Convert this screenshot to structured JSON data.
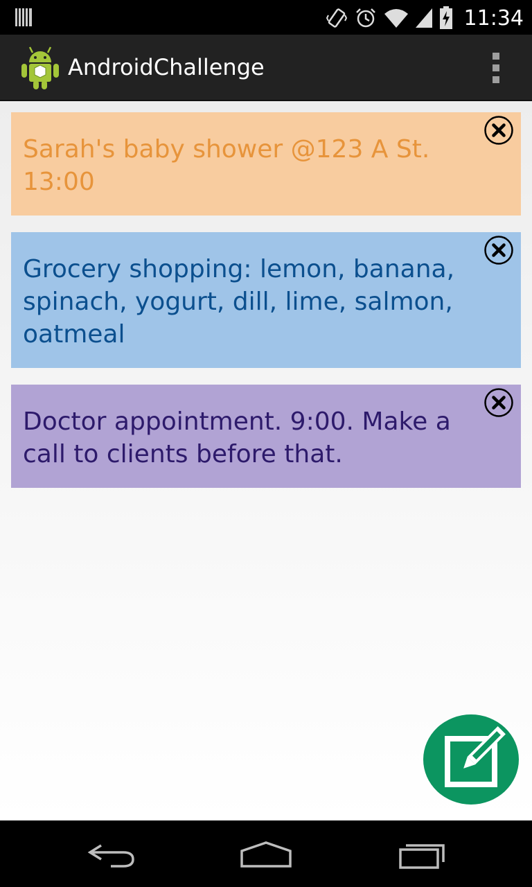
{
  "status_bar": {
    "time": "11:34",
    "icons": [
      "barcode-icon",
      "vibrate-icon",
      "alarm-icon",
      "wifi-icon",
      "signal-icon",
      "battery-charging-icon"
    ]
  },
  "action_bar": {
    "title": "AndroidChallenge",
    "app_icon": "android-robot-icon",
    "overflow_icon": "overflow-menu-icon"
  },
  "notes": [
    {
      "text": "Sarah's baby shower @123 A St. 13:00",
      "bg_color": "#f8cc9f",
      "text_color": "#e7943b"
    },
    {
      "text": "Grocery shopping: lemon, banana, spinach, yogurt, dill, lime, salmon, oatmeal",
      "bg_color": "#9fc4e8",
      "text_color": "#0b4f8e"
    },
    {
      "text": "Doctor appointment. 9:00.  Make a call to clients before that.",
      "bg_color": "#b1a3d4",
      "text_color": "#2d1a6b"
    }
  ],
  "fab": {
    "icon": "edit-note-icon",
    "color": "#0c9560"
  },
  "nav_bar": {
    "icons": [
      "back-icon",
      "home-icon",
      "recent-apps-icon"
    ]
  }
}
